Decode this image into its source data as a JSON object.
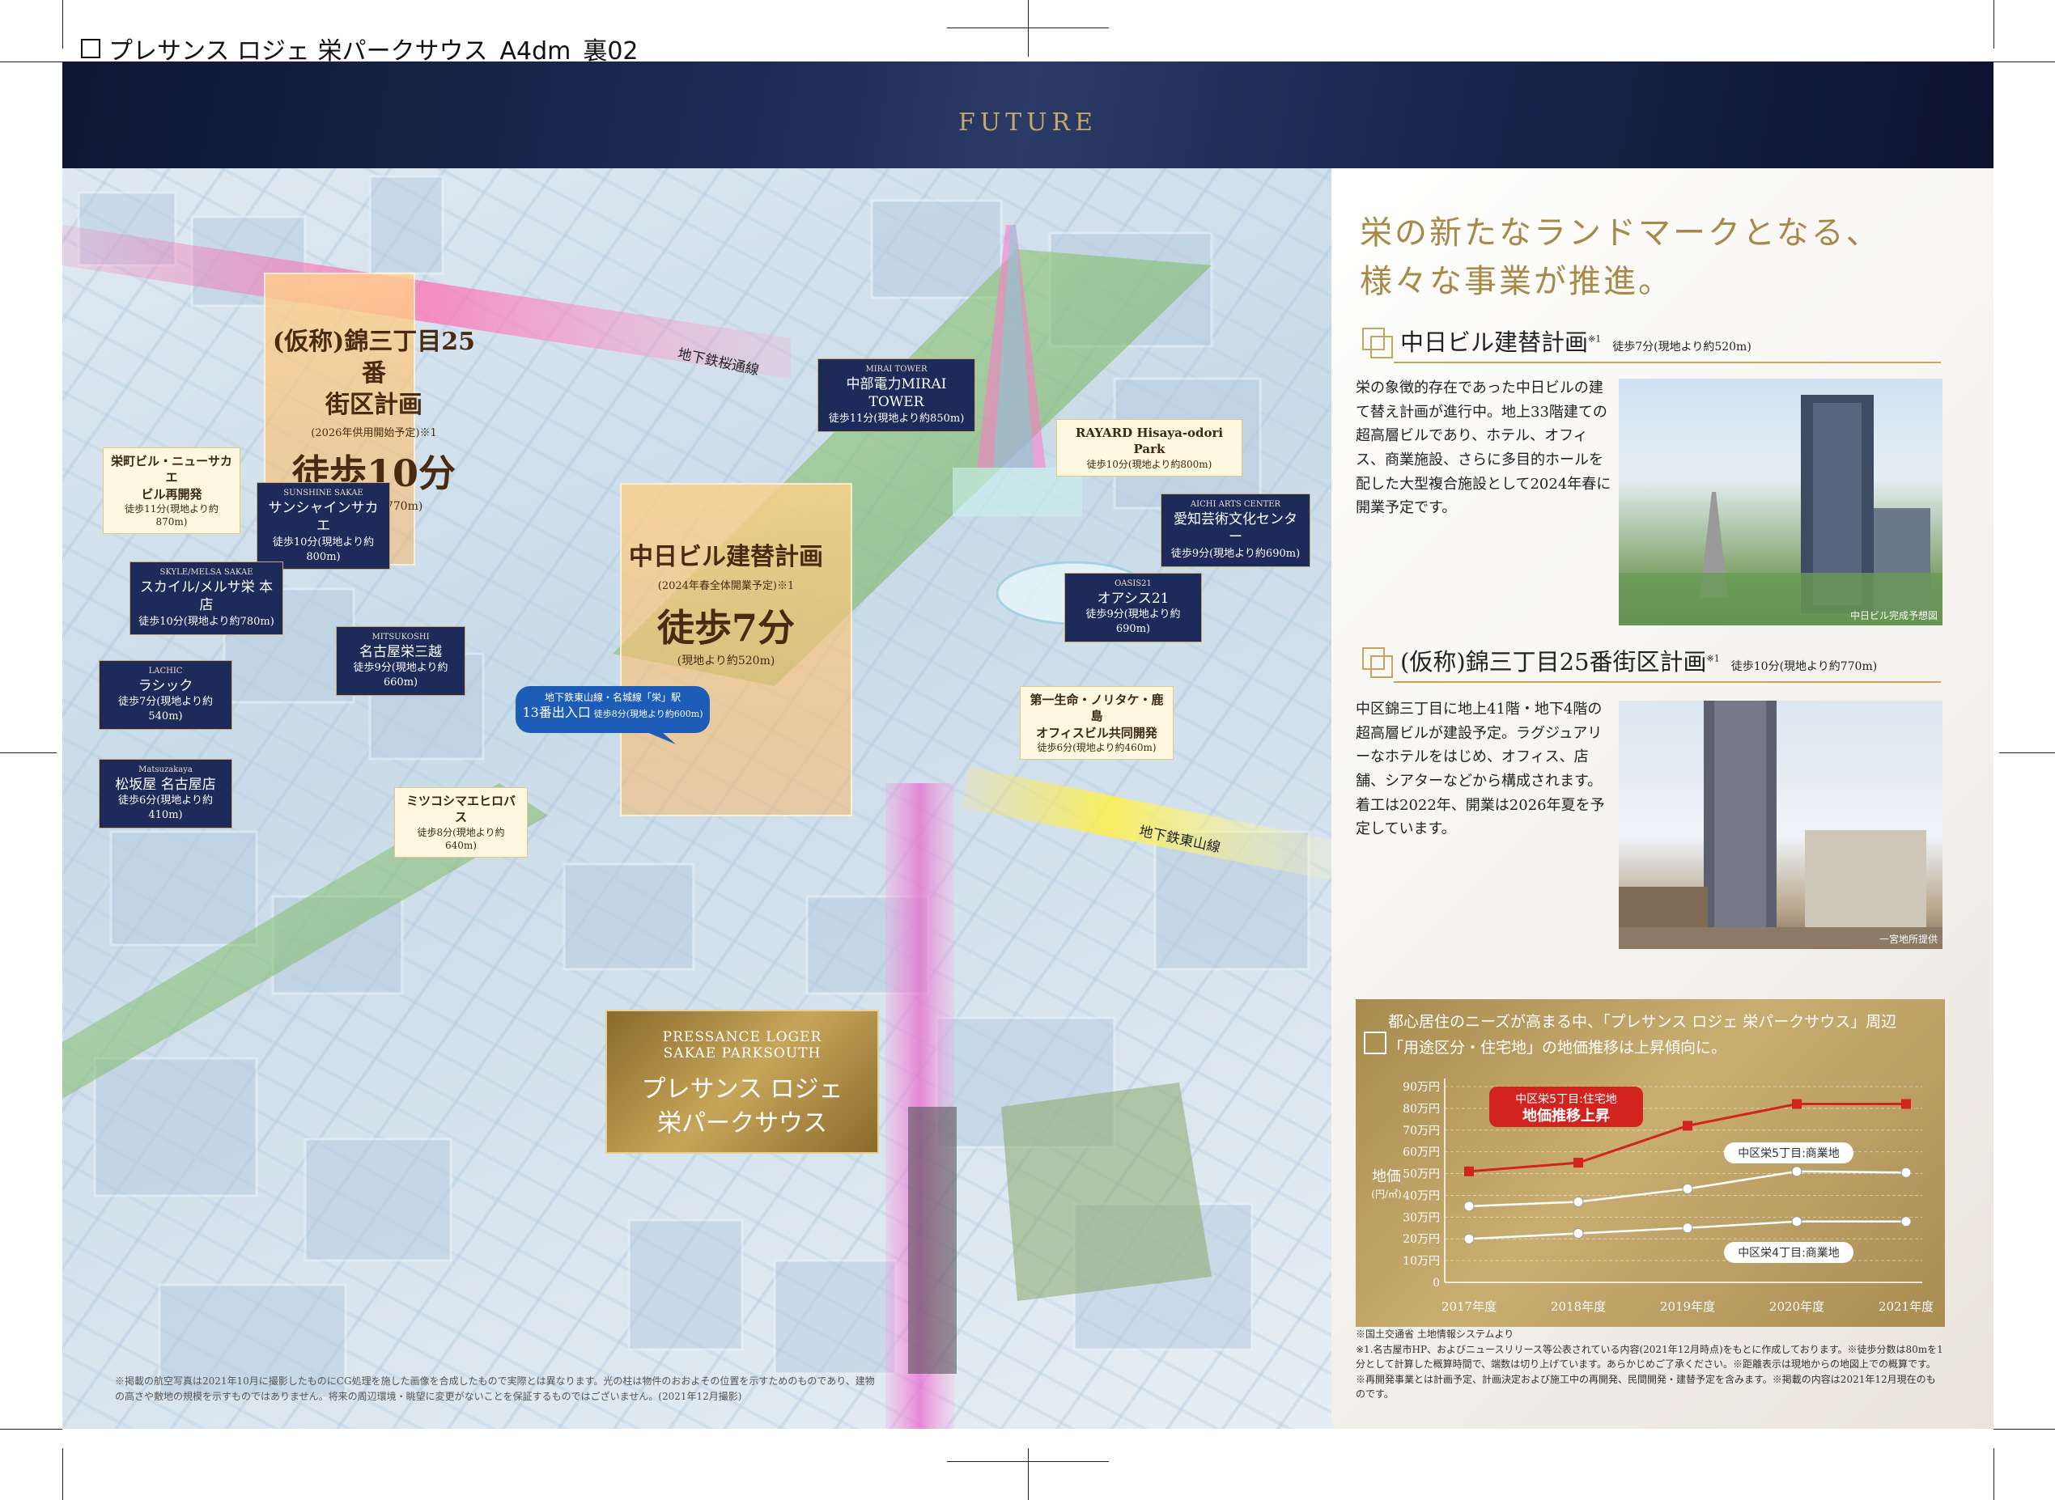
{
  "doc_title": "プレサンス ロジェ 栄パークサウス_A4dm_裏02",
  "header": {
    "future": "FUTURE"
  },
  "map": {
    "rail_lines": [
      {
        "name": "地下鉄桜通線"
      },
      {
        "name": "地下鉄東山線"
      }
    ],
    "labels": [
      {
        "en": "",
        "jp": "栄町ビル・ニューサカエ\nビル再開発",
        "walk": "徒歩11分(現地より約870m)"
      },
      {
        "en": "SUNSHINE SAKAE",
        "jp": "サンシャインサカエ",
        "walk": "徒歩10分(現地より約800m)"
      },
      {
        "en": "SKYLE/MELSA SAKAE",
        "jp": "スカイル/メルサ栄 本店",
        "walk": "徒歩10分(現地より約780m)"
      },
      {
        "en": "MITSUKOSHI",
        "jp": "名古屋栄三越",
        "walk": "徒歩9分(現地より約660m)"
      },
      {
        "en": "LACHIC",
        "jp": "ラシック",
        "walk": "徒歩7分(現地より約540m)"
      },
      {
        "en": "Matsuzakaya",
        "jp": "松坂屋 名古屋店",
        "walk": "徒歩6分(現地より約410m)"
      },
      {
        "en": "MIRAI TOWER",
        "jp": "中部電力MIRAI TOWER",
        "walk": "徒歩11分(現地より約850m)"
      },
      {
        "en": "",
        "jp": "RAYARD Hisaya-odori Park",
        "walk": "徒歩10分(現地より約800m)"
      },
      {
        "en": "AICHI ARTS CENTER",
        "jp": "愛知芸術文化センター",
        "walk": "徒歩9分(現地より約690m)"
      },
      {
        "en": "OASIS21",
        "jp": "オアシス21",
        "walk": "徒歩9分(現地より約690m)"
      },
      {
        "en": "",
        "jp": "第一生命・ノリタケ・鹿島\nオフィスビル共同開発",
        "walk": "徒歩6分(現地より約460m)"
      },
      {
        "en": "",
        "jp": "ミツコシマエヒロバス",
        "walk": "徒歩8分(現地より約640m)"
      },
      {
        "en": "地下鉄東山線・名城線「栄」駅",
        "jp": "13番出入口",
        "walk": "徒歩8分(現地より約600m)"
      }
    ],
    "big1": {
      "title": "(仮称)錦三丁目25番\n街区計画",
      "sub": "(2026年供用開始予定)※1",
      "walk": "徒歩10分",
      "dist": "(現地より約770m)"
    },
    "big2": {
      "title": "中日ビル建替計画",
      "sub": "(2024年春全体開業予定)※1",
      "walk": "徒歩7分",
      "dist": "(現地より約520m)"
    },
    "property": {
      "en": "PRESSANCE LOGER\nSAKAE PARKSOUTH",
      "jp": "プレサンス ロジェ\n栄パークサウス"
    },
    "disclaimer": "※掲載の航空写真は2021年10月に撮影したものにCG処理を施した画像を合成したもので実際とは異なります。光の柱は物件のおおよその位置を示すためのものであり、建物の高さや敷地の規模を示すものではありません。将来の周辺環境・眺望に変更がないことを保証するものではございません。(2021年12月撮影)"
  },
  "right": {
    "headline": "栄の新たなランドマークとなる、\n様々な事業が推進。",
    "sec1": {
      "title": "中日ビル建替計画",
      "sup": "※1",
      "walk": "徒歩7分(現地より約520m)",
      "text": "栄の象徴的存在であった中日ビルの建て替え計画が進行中。地上33階建ての超高層ビルであり、ホテル、オフィス、商業施設、さらに多目的ホールを配した大型複合施設として2024年春に開業予定です。",
      "caption": "中日ビル完成予想図"
    },
    "sec2": {
      "title": "(仮称)錦三丁目25番街区計画",
      "sup": "※1",
      "walk": "徒歩10分(現地より約770m)",
      "text": "中区錦三丁目に地上41階・地下4階の超高層ビルが建設予定。ラグジュアリーなホテルをはじめ、オフィス、店舗、シアターなどから構成されます。着工は2022年、開業は2026年夏を予定しています。",
      "caption": "一宮地所提供"
    },
    "chart_head": "都心居住のニーズが高まる中、「プレサンス ロジェ 栄パークサウス」周辺\n「用途区分・住宅地」の地価推移は上昇傾向に。",
    "notes": "※国土交通省 土地情報システムより\n※1.名古屋市HP、およびニュースリリース等公表されている内容(2021年12月時点)をもとに作成しております。※徒歩分数は80mを1分として計算した概算時間で、端数は切り上げています。あらかじめご了承ください。※距離表示は現地からの地図上での概算です。※再開発事業とは計画予定、計画決定および施工中の再開発、民間開発・建替予定を含みます。※掲載の内容は2021年12月現在のものです。"
  },
  "chart_data": {
    "type": "line",
    "x": [
      "2017年度",
      "2018年度",
      "2019年度",
      "2020年度",
      "2021年度"
    ],
    "ylabel": "地価\n(円/㎡)",
    "ylim": [
      0,
      900000
    ],
    "y_ticks": [
      "0",
      "10万円",
      "20万円",
      "30万円",
      "40万円",
      "50万円",
      "60万円",
      "70万円",
      "80万円",
      "90万円"
    ],
    "series": [
      {
        "name": "中区栄5丁目:住宅地",
        "values": [
          510000,
          550000,
          720000,
          820000,
          820000
        ],
        "color": "#d2231e",
        "callout": "地価推移上昇"
      },
      {
        "name": "中区栄5丁目:商業地",
        "values": [
          350000,
          370000,
          430000,
          510000,
          505000
        ],
        "color": "#ffffff"
      },
      {
        "name": "中区栄4丁目:商業地",
        "values": [
          200000,
          225000,
          250000,
          280000,
          280000
        ],
        "color": "#ffffff"
      }
    ]
  }
}
